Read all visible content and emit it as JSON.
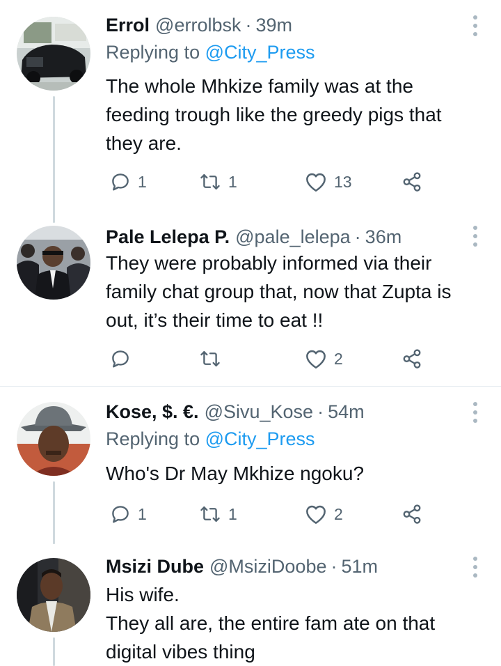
{
  "tweets": [
    {
      "name": "Errol",
      "handle": "@errolbsk",
      "time": "39m",
      "replying_prefix": "Replying to",
      "replying_to": "@City_Press",
      "text_lines": [
        "The whole Mhkize family was at the",
        "feeding trough like the greedy pigs that",
        "they are."
      ],
      "replies": "1",
      "retweets": "1",
      "likes": "13"
    },
    {
      "name": "Pale Lelepa P.",
      "handle": "@pale_lelepa",
      "time": "36m",
      "text_lines": [
        "They were probably informed via their",
        "family chat group that, now that Zupta is",
        "out, it’s their time to eat !!"
      ],
      "replies": "",
      "retweets": "",
      "likes": "2"
    },
    {
      "name": "Kose, $. €.",
      "handle": "@Sivu_Kose",
      "time": "54m",
      "replying_prefix": "Replying to",
      "replying_to": "@City_Press",
      "text_lines": [
        "Who's Dr May Mkhize ngoku?"
      ],
      "replies": "1",
      "retweets": "1",
      "likes": "2"
    },
    {
      "name": "Msizi Dube",
      "handle": "@MsiziDoobe",
      "time": "51m",
      "text_lines": [
        "His wife.",
        "They all are, the entire fam ate on that",
        "digital vibes thing"
      ]
    }
  ],
  "dot_separator": "·",
  "colors": {
    "text": "#0f1419",
    "secondary": "#536471",
    "link": "#1d9bf0",
    "divider": "#e6ecf0",
    "thread_line": "#cfd9de"
  }
}
